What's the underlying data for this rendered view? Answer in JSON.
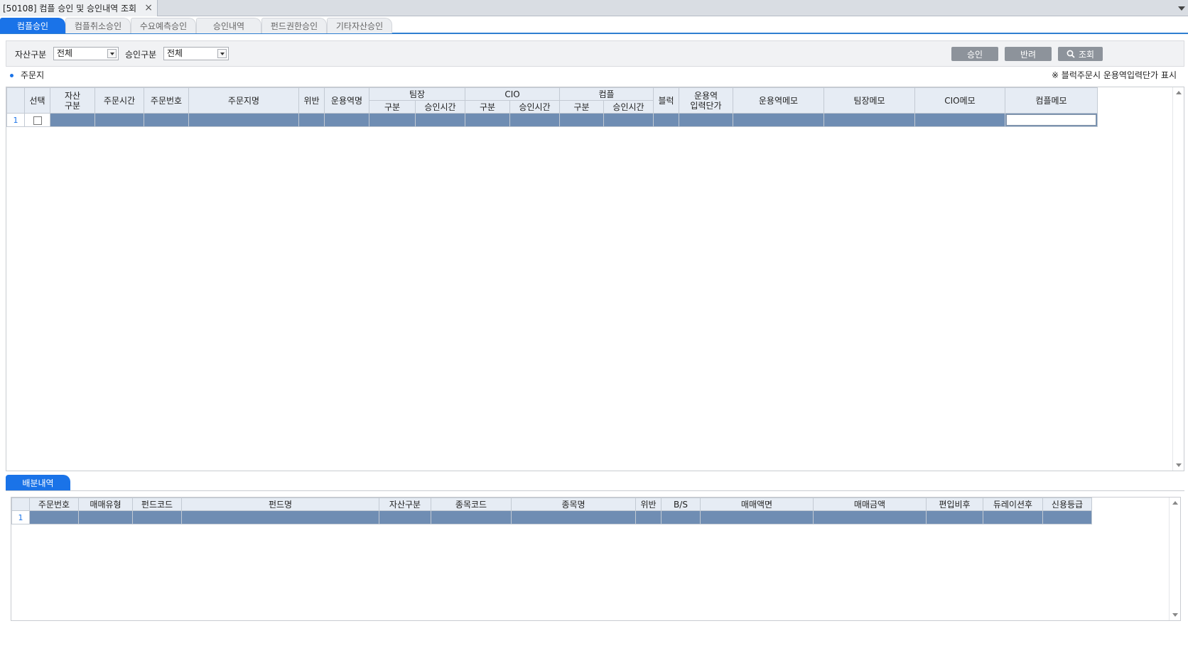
{
  "window": {
    "title": "[50108] 컴플 승인 및 승인내역 조회",
    "close_glyph": "×"
  },
  "tabs": [
    {
      "label": "컴플승인"
    },
    {
      "label": "컴플취소승인"
    },
    {
      "label": "수요예측승인"
    },
    {
      "label": "승인내역"
    },
    {
      "label": "펀드권한승인"
    },
    {
      "label": "기타자산승인"
    }
  ],
  "filters": {
    "asset_label": "자산구분",
    "asset_value": "전체",
    "approval_label": "승인구분",
    "approval_value": "전체"
  },
  "buttons": {
    "approve": "승인",
    "reject": "반려",
    "search": "조회"
  },
  "order_section": {
    "title": "주문지",
    "note": "※ 블럭주문시 운용역입력단가 표시"
  },
  "order_grid": {
    "headers": {
      "select": "선택",
      "asset_type": "자산\n구분",
      "order_time": "주문시간",
      "order_no": "주문번호",
      "order_name": "주문지명",
      "violation": "위반",
      "manager_name": "운용역명",
      "team_lead": "팀장",
      "cio": "CIO",
      "compliance": "컴플",
      "type_sub": "구분",
      "approval_time_sub": "승인시간",
      "block": "블럭",
      "manager_input_price": "운용역\n입력단가",
      "manager_memo": "운용역메모",
      "team_lead_memo": "팀장메모",
      "cio_memo": "CIO메모",
      "compliance_memo": "컴플메모"
    },
    "rows": [
      {
        "row_no": "1"
      }
    ]
  },
  "allocation_section": {
    "tab_label": "배분내역"
  },
  "allocation_grid": {
    "headers": [
      "주문번호",
      "매매유형",
      "펀드코드",
      "펀드명",
      "자산구분",
      "종목코드",
      "종목명",
      "위반",
      "B/S",
      "매매액면",
      "매매금액",
      "편입비후",
      "듀레이션후",
      "신용등급"
    ],
    "rows": [
      {
        "row_no": "1"
      }
    ]
  }
}
